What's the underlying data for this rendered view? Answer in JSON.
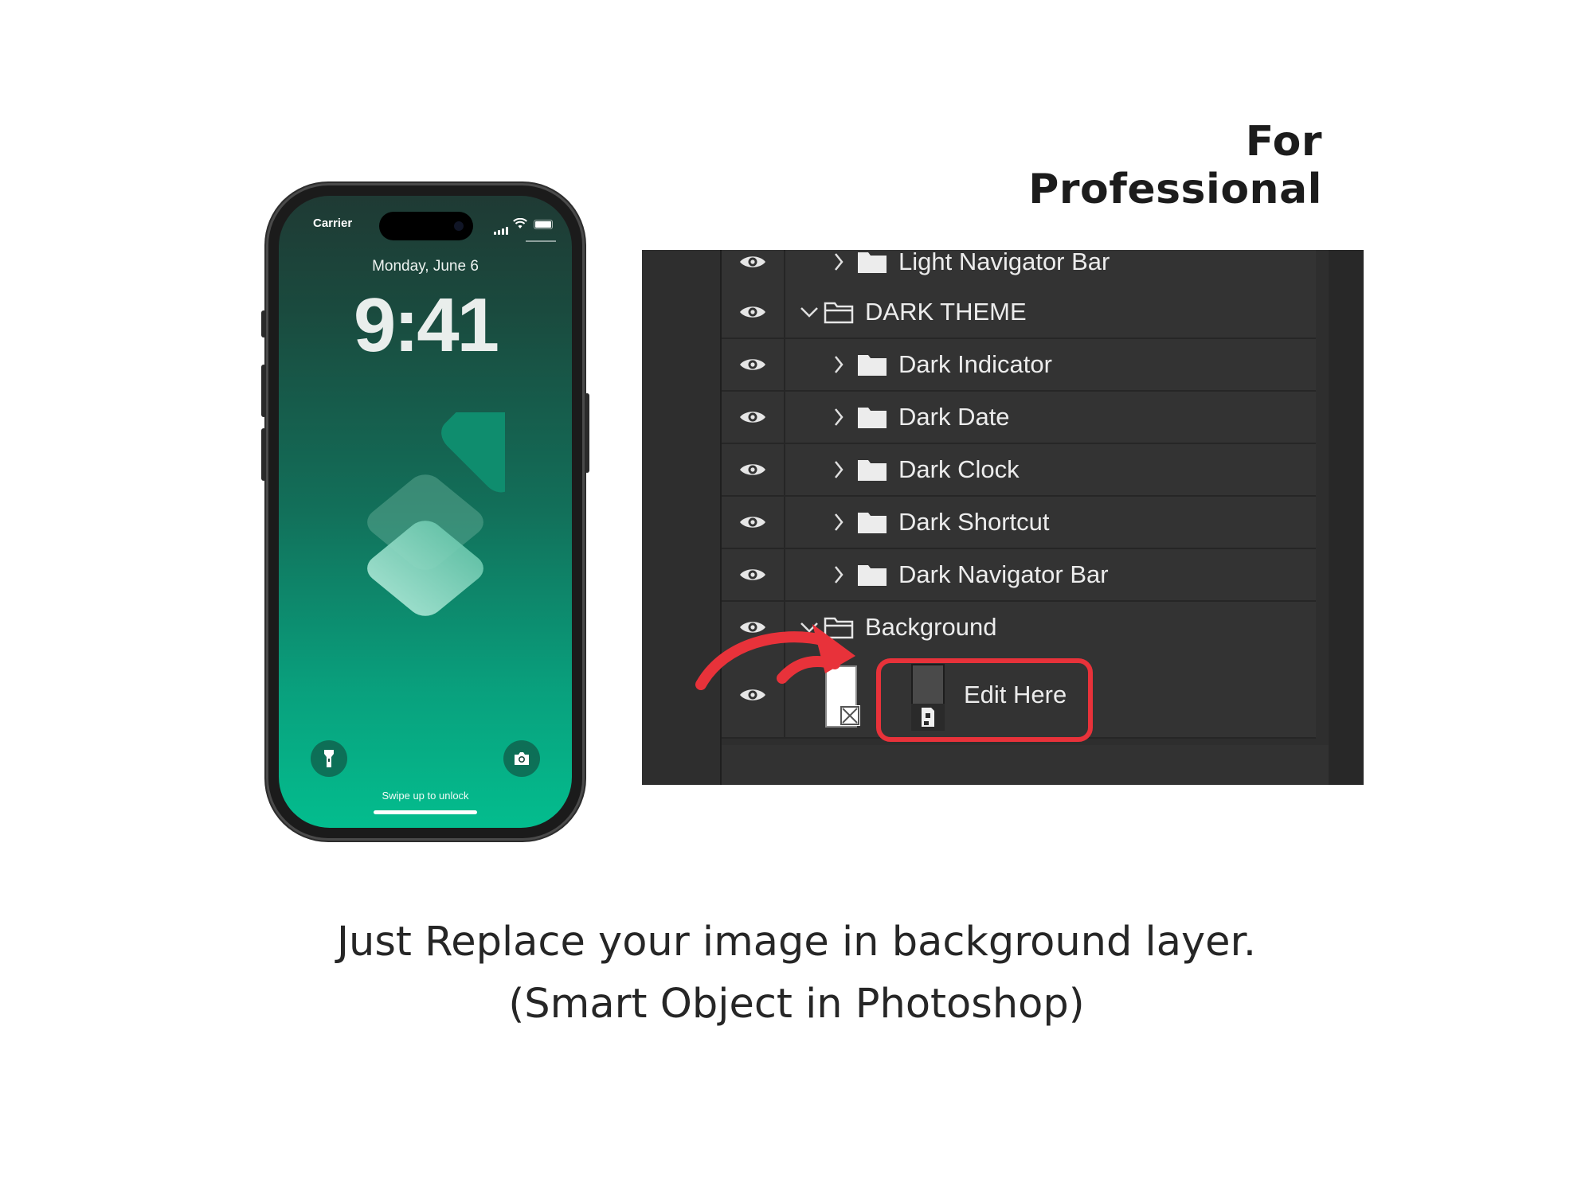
{
  "heading": "For Professional",
  "phone": {
    "carrier": "Carrier",
    "date": "Monday, June 6",
    "time": "9:41",
    "swipe_text": "Swipe up to unlock",
    "icons": {
      "flashlight": "flashlight-icon",
      "camera": "camera-icon",
      "signal": "signal-icon",
      "wifi": "wifi-icon",
      "battery": "battery-icon"
    }
  },
  "layers": [
    {
      "name": "Light Navigator Bar",
      "type": "group",
      "expanded": false,
      "indent": 1
    },
    {
      "name": "DARK THEME",
      "type": "group",
      "expanded": true,
      "indent": 0
    },
    {
      "name": "Dark Indicator",
      "type": "group",
      "expanded": false,
      "indent": 1
    },
    {
      "name": "Dark Date",
      "type": "group",
      "expanded": false,
      "indent": 1
    },
    {
      "name": "Dark Clock",
      "type": "group",
      "expanded": false,
      "indent": 1
    },
    {
      "name": "Dark Shortcut",
      "type": "group",
      "expanded": false,
      "indent": 1
    },
    {
      "name": "Dark Navigator Bar",
      "type": "group",
      "expanded": false,
      "indent": 1
    },
    {
      "name": "Background",
      "type": "group",
      "expanded": true,
      "indent": 0
    },
    {
      "name": "Edit Here",
      "type": "smart-object",
      "indent": 1
    }
  ],
  "colors": {
    "highlight": "#e8323a",
    "panel_bg": "#2e2e2e",
    "row_bg": "#333333",
    "phone_gradient_top": "#1f3a34",
    "phone_gradient_bottom": "#03bd8e"
  },
  "caption": {
    "line1": "Just Replace your image in background layer.",
    "line2": "(Smart Object in Photoshop)"
  }
}
